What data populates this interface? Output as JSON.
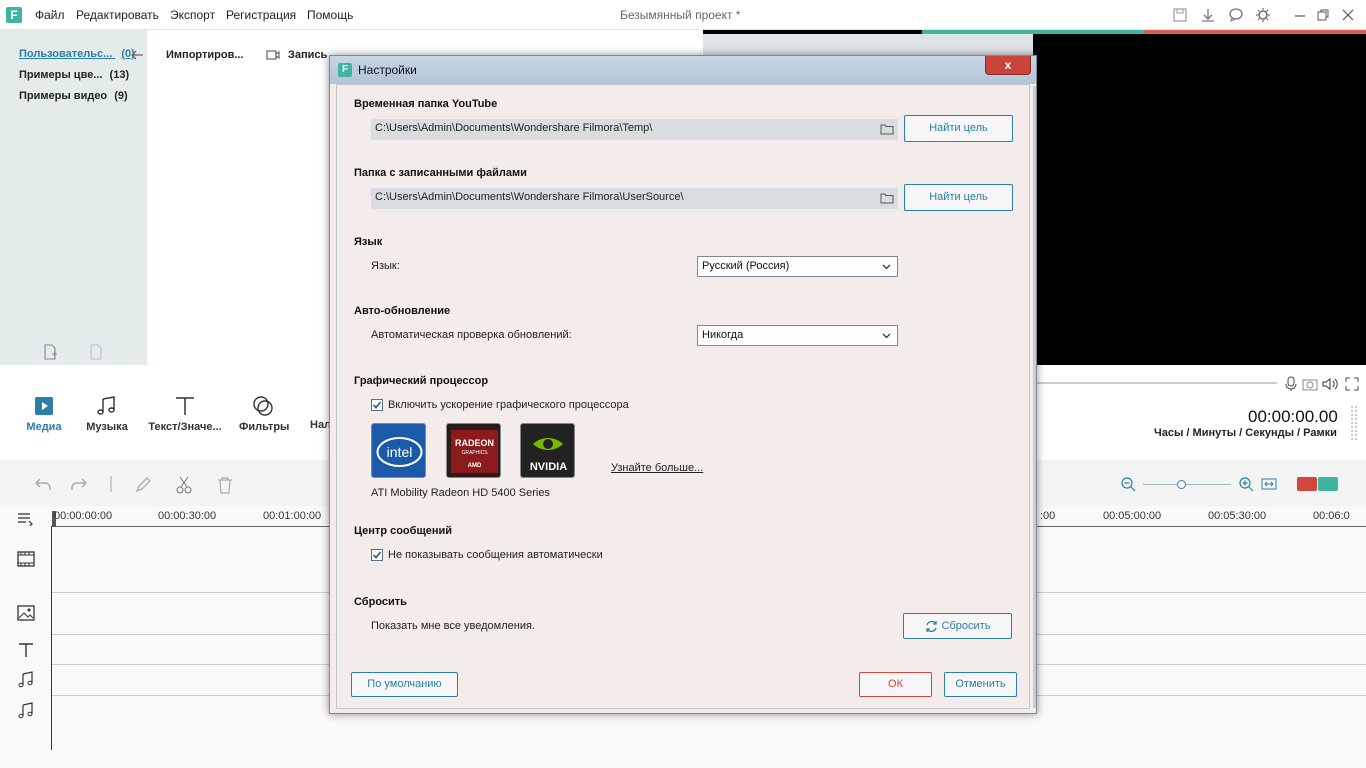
{
  "app": {
    "logo_letter": "F",
    "project_title": "Безымянный проект *"
  },
  "menu": [
    {
      "label": "Файл"
    },
    {
      "label": "Редактировать"
    },
    {
      "label": "Экспорт"
    },
    {
      "label": "Регистрация"
    },
    {
      "label": "Помощь"
    }
  ],
  "library": {
    "items": [
      {
        "label": "Пользовательс...",
        "count": "(0)"
      },
      {
        "label": "Примеры цве...",
        "count": "(13)"
      },
      {
        "label": "Примеры видео",
        "count": "(9)"
      }
    ],
    "import_label": "Импортиров...",
    "record_label": "Запись"
  },
  "tools": {
    "tabs": [
      {
        "label": "Медиа"
      },
      {
        "label": "Музыка"
      },
      {
        "label": "Текст/Значе..."
      },
      {
        "label": "Фильтры"
      },
      {
        "label": "Нал"
      }
    ]
  },
  "player": {
    "time": "00:00:00.00",
    "units": "Часы / Минуты / Секунды / Рамки"
  },
  "timeline": {
    "ruler": [
      "00:00:00:00",
      "00:00:30:00",
      "00:01:00:00",
      ":00",
      "00:05:00:00",
      "00:05:30:00",
      "00:06:0"
    ]
  },
  "dialog": {
    "logo_letter": "F",
    "title": "Настройки",
    "close_glyph": "x",
    "youtube": {
      "title": "Временная папка YouTube",
      "path": "C:\\Users\\Admin\\Documents\\Wondershare Filmora\\Temp\\",
      "button": "Найти цель"
    },
    "records": {
      "title": "Папка с записанными файлами",
      "path": "C:\\Users\\Admin\\Documents\\Wondershare Filmora\\UserSource\\",
      "button": "Найти цель"
    },
    "language": {
      "title": "Язык",
      "label": "Язык:",
      "value": "Русский (Россия)"
    },
    "update": {
      "title": "Авто-обновление",
      "label": "Автоматическая проверка обновлений:",
      "value": "Никогда"
    },
    "gpu": {
      "title": "Графический процессор",
      "checkbox_label": "Включить ускорение графического процессора",
      "checked": true,
      "learn_more": "Узнайте больше...",
      "device": "ATI Mobility Radeon HD 5400 Series",
      "logos": {
        "intel": "intel",
        "radeon": "RADEON",
        "radeon_sub": "GRAPHICS",
        "amd": "AMD",
        "nvidia": "NVIDIA"
      }
    },
    "messages": {
      "title": "Центр сообщений",
      "checkbox_label": "Не показывать сообщения автоматически",
      "checked": true
    },
    "reset": {
      "title": "Сбросить",
      "label": "Показать мне все уведомления.",
      "button": "Сбросить"
    },
    "footer": {
      "default": "По умолчанию",
      "ok": "ОК",
      "cancel": "Отменить"
    }
  },
  "colors": {
    "accent": "#2b7fa8",
    "brand": "#3fb5a0",
    "danger": "#d2463b"
  }
}
